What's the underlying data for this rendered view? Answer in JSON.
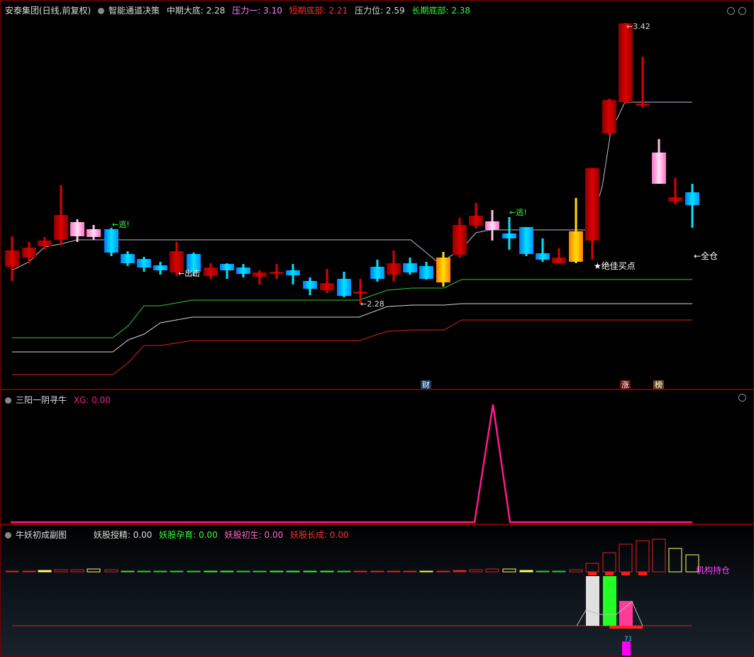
{
  "panel1": {
    "stock": "安泰集团(日线,前复权)",
    "indicator": "智能通道决策",
    "labels": [
      {
        "text": "中期大底: 2.28",
        "color": "#dddddd"
      },
      {
        "text": "压力一: 3.10",
        "color": "#ff80ff"
      },
      {
        "text": "短期底部: 2.21",
        "color": "#ff3030"
      },
      {
        "text": "压力位: 2.59",
        "color": "#dddddd"
      },
      {
        "text": "长期底部: 2.38",
        "color": "#33ff33"
      }
    ],
    "annotations": {
      "escape1": "←逃!",
      "escape2": "←逃!",
      "exit": "←出击",
      "low": "2.28",
      "high": "3.42",
      "best_buy": "★绝佳买点",
      "full": "←全仓"
    },
    "marks": {
      "cai": "财",
      "zhang": "涨",
      "bang": "榜"
    }
  },
  "panel2": {
    "title": "三阳一阴寻牛",
    "xg": "XG: 0.00"
  },
  "panel3": {
    "title": "牛妖初成副图",
    "labels": [
      {
        "text": "妖股授精: 0.00",
        "color": "#dddddd"
      },
      {
        "text": "妖股孕育: 0.00",
        "color": "#33ff33"
      },
      {
        "text": "妖股初生: 0.00",
        "color": "#ff66cc"
      },
      {
        "text": "妖股长成: 0.00",
        "color": "#ff3030"
      }
    ],
    "holding": "机构持仓",
    "count": "71"
  },
  "colors": {
    "border": "#7a0000",
    "up": "#d40000",
    "down": "#00c8ff",
    "pink": "#ff9ad8",
    "gold": "#ffb000"
  }
}
